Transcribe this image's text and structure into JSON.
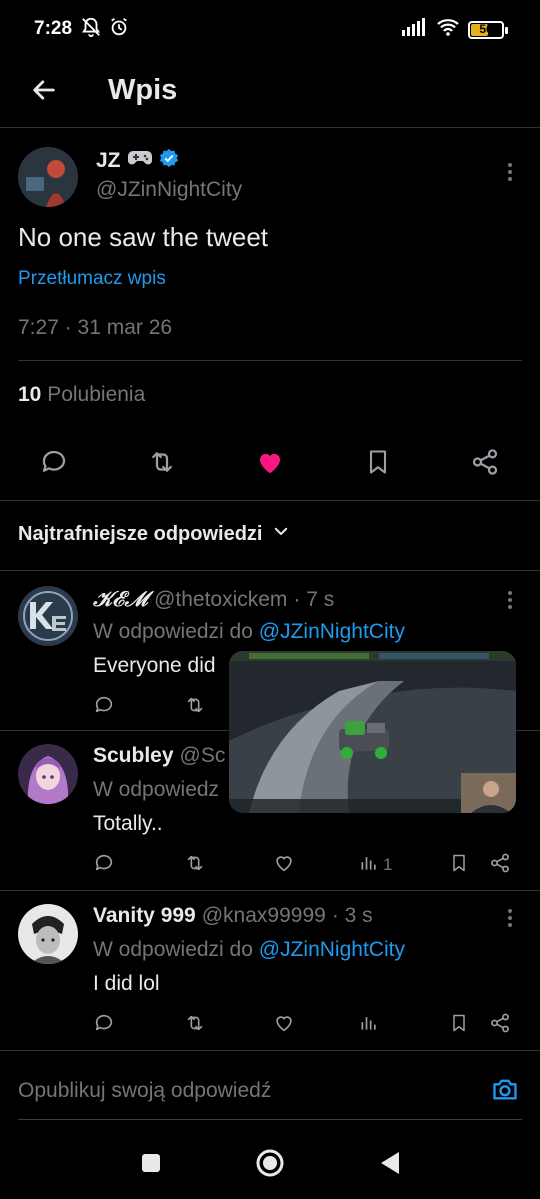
{
  "status": {
    "time": "7:28",
    "battery": "56",
    "battery_level": 0.56
  },
  "header": {
    "title": "Wpis"
  },
  "tweet": {
    "author_name": "JZ",
    "author_handle": "@JZinNightCity",
    "text": "No one saw the tweet",
    "translate_label": "Przetłumacz wpis",
    "timestamp": "7:27 · 31 mar 26",
    "likes_count": "10",
    "likes_label": "Polubienia",
    "liked": true
  },
  "replies_section": {
    "sort_label": "Najtrafniejsze odpowiedzi"
  },
  "replies": [
    {
      "name": "𝒦ℰℳ",
      "handle": "@thetoxickem",
      "time": "· 7 s",
      "replying_prefix": "W odpowiedzi do",
      "replying_to": "@JZinNightCity",
      "text": "Everyone did",
      "views": ""
    },
    {
      "name": "Scubley",
      "handle": "@Sc",
      "time": "",
      "replying_prefix": "W odpowiedz",
      "replying_to": "",
      "text": "Totally..",
      "views": "1"
    },
    {
      "name": "Vanity 999",
      "handle": "@knax99999",
      "time": "· 3 s",
      "replying_prefix": "W odpowiedzi do",
      "replying_to": "@JZinNightCity",
      "text": "I did lol",
      "views": ""
    }
  ],
  "compose": {
    "placeholder": "Opublikuj swoją odpowiedź"
  },
  "colors": {
    "accent": "#1d9bf0",
    "like": "#f91880",
    "verified": "#1d9bf0",
    "background": "#000000"
  }
}
